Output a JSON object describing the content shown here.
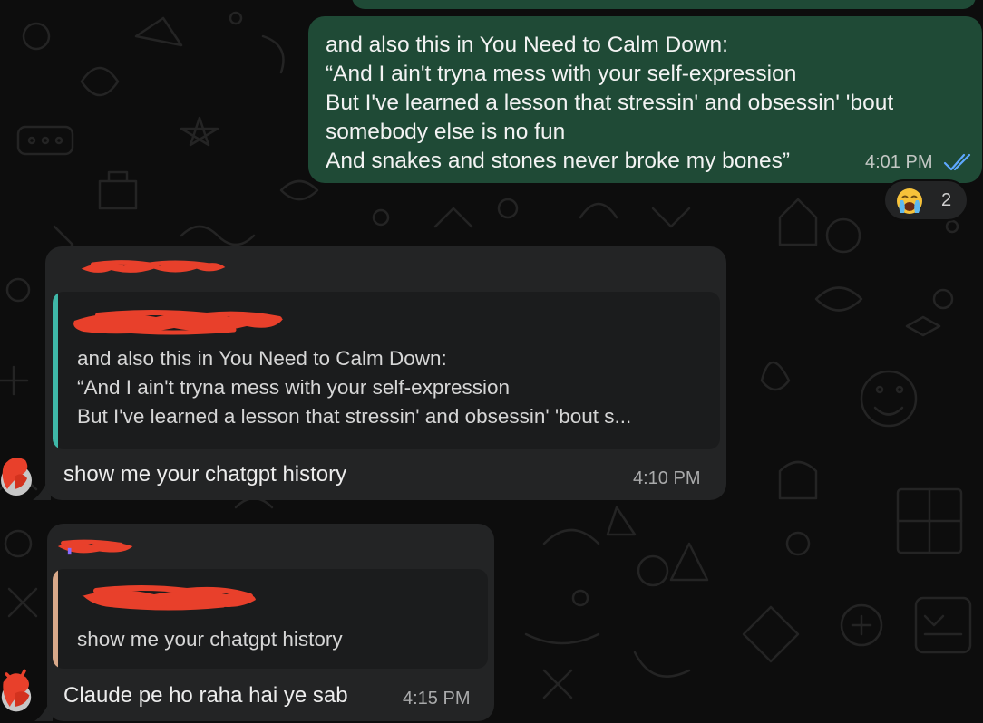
{
  "colors": {
    "outgoing_bubble": "#1f4a36",
    "incoming_bubble": "#232425",
    "quote_bg": "#1b1c1d",
    "quote_bar_teal": "#3fb8a8",
    "quote_bar_peach": "#d9a98a",
    "read_ticks": "#5ea8ff",
    "redaction": "#e8402b"
  },
  "messages": [
    {
      "direction": "outgoing",
      "lines": [
        "and also this in You Need to Calm Down:",
        "“And I ain't tryna mess with your self-expression",
        "But I've learned a lesson that stressin' and obsessin' 'bout",
        "somebody else is no fun",
        "And snakes and stones never broke my bones”"
      ],
      "time": "4:01 PM",
      "status_icon": "double-check-icon",
      "reaction": {
        "emoji": "loudly-crying-face",
        "count": "2"
      }
    },
    {
      "direction": "incoming",
      "sender": "[redacted]",
      "quote": {
        "author": "[redacted]",
        "lines": [
          "and also this in You Need to Calm Down:",
          "“And I ain't tryna mess with your self-expression",
          "But I've learned a lesson that stressin' and obsessin' 'bout s..."
        ]
      },
      "text": "show me your chatgpt history",
      "time": "4:10 PM"
    },
    {
      "direction": "incoming",
      "sender": "[redacted]",
      "quote": {
        "author": "[redacted]",
        "lines": [
          "show me your chatgpt history"
        ]
      },
      "text": "Claude pe ho raha hai ye sab",
      "time": "4:15 PM"
    }
  ]
}
